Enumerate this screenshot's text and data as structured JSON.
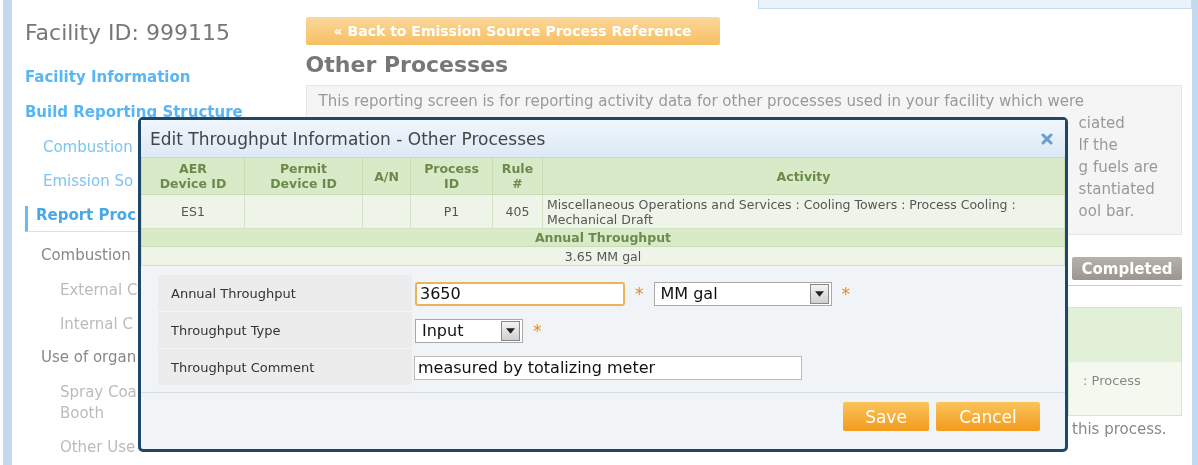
{
  "facility_title": "Facility ID: 999115",
  "sidebar": {
    "items": [
      {
        "label": "Facility Information",
        "kind": "section",
        "selected": false
      },
      {
        "label": "Build Reporting Structure",
        "kind": "section",
        "selected": false,
        "children": [
          {
            "label": "Combustion",
            "kind": "link",
            "selected": false
          },
          {
            "label": "Emission So",
            "kind": "link",
            "selected": false
          },
          {
            "label": "Report Proc",
            "kind": "link",
            "selected": true,
            "children": [
              {
                "label": "Combustion",
                "kind": "group",
                "selected": false,
                "children": [
                  {
                    "label": "External C",
                    "kind": "leaf",
                    "selected": false
                  },
                  {
                    "label": "Internal C",
                    "kind": "leaf",
                    "selected": false
                  }
                ]
              },
              {
                "label": "Use of organ",
                "kind": "group",
                "selected": false,
                "children": [
                  {
                    "label": "Spray Coa\nBooth",
                    "kind": "leaf",
                    "selected": false
                  },
                  {
                    "label": "Other Use",
                    "kind": "leaf",
                    "selected": false
                  }
                ]
              }
            ]
          }
        ]
      }
    ]
  },
  "back_button": "« Back to Emission Source Process Reference",
  "heading": "Other Processes",
  "description": {
    "first_line": "This reporting screen is for reporting activity data for other processes used in your facility which were",
    "fragments": [
      "ciated",
      "If the",
      "g fuels are",
      "stantiated",
      "ool bar."
    ]
  },
  "completed_button": "Completed",
  "process_panel": {
    "text": ": Process"
  },
  "note_fragment": "this process.",
  "dialog": {
    "title": "Edit Throughput Information - Other Processes",
    "columns": [
      "AER\nDevice ID",
      "Permit\nDevice ID",
      "A/N",
      "Process\nID",
      "Rule\n#",
      "Activity"
    ],
    "cells": [
      "ES1",
      null,
      null,
      "P1",
      "405",
      "Miscellaneous Operations and Services : Cooling Towers : Process Cooling : Mechanical Draft"
    ],
    "summary": {
      "heading": "Annual Throughput",
      "value": "3.65 MM gal"
    },
    "required_mark": "*",
    "fields": [
      {
        "kind": "text-unit",
        "label": "Annual Throughput",
        "value": "3650",
        "focused": true,
        "required": true,
        "unit": "MM gal",
        "unit_required": true
      },
      {
        "kind": "select",
        "label": "Throughput Type",
        "value": "Input",
        "focused": false,
        "required": true
      },
      {
        "kind": "text",
        "label": "Throughput Comment",
        "value": "measured by totalizing meter",
        "focused": false,
        "required": false
      }
    ],
    "buttons": [
      "Save",
      "Cancel"
    ]
  }
}
